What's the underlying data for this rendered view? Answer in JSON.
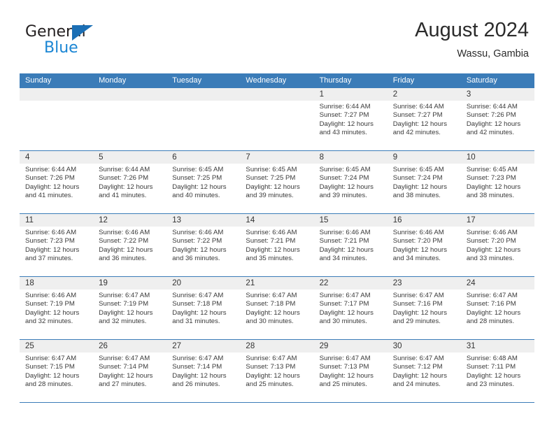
{
  "branding": {
    "name_dark": "General",
    "name_light": "Blue",
    "accent_blue": "#1b6fb5",
    "light_blue": "#1b86d4"
  },
  "header": {
    "title": "August 2024",
    "location": "Wassu, Gambia"
  },
  "calendar": {
    "header_bg": "#3b7cb8",
    "daynum_bg": "#efefef",
    "weekdays": [
      "Sunday",
      "Monday",
      "Tuesday",
      "Wednesday",
      "Thursday",
      "Friday",
      "Saturday"
    ],
    "weeks": [
      [
        {
          "day": "",
          "empty": true
        },
        {
          "day": "",
          "empty": true
        },
        {
          "day": "",
          "empty": true
        },
        {
          "day": "",
          "empty": true
        },
        {
          "day": "1",
          "sunrise": "Sunrise: 6:44 AM",
          "sunset": "Sunset: 7:27 PM",
          "daylight1": "Daylight: 12 hours",
          "daylight2": "and 43 minutes."
        },
        {
          "day": "2",
          "sunrise": "Sunrise: 6:44 AM",
          "sunset": "Sunset: 7:27 PM",
          "daylight1": "Daylight: 12 hours",
          "daylight2": "and 42 minutes."
        },
        {
          "day": "3",
          "sunrise": "Sunrise: 6:44 AM",
          "sunset": "Sunset: 7:26 PM",
          "daylight1": "Daylight: 12 hours",
          "daylight2": "and 42 minutes."
        }
      ],
      [
        {
          "day": "4",
          "sunrise": "Sunrise: 6:44 AM",
          "sunset": "Sunset: 7:26 PM",
          "daylight1": "Daylight: 12 hours",
          "daylight2": "and 41 minutes."
        },
        {
          "day": "5",
          "sunrise": "Sunrise: 6:44 AM",
          "sunset": "Sunset: 7:26 PM",
          "daylight1": "Daylight: 12 hours",
          "daylight2": "and 41 minutes."
        },
        {
          "day": "6",
          "sunrise": "Sunrise: 6:45 AM",
          "sunset": "Sunset: 7:25 PM",
          "daylight1": "Daylight: 12 hours",
          "daylight2": "and 40 minutes."
        },
        {
          "day": "7",
          "sunrise": "Sunrise: 6:45 AM",
          "sunset": "Sunset: 7:25 PM",
          "daylight1": "Daylight: 12 hours",
          "daylight2": "and 39 minutes."
        },
        {
          "day": "8",
          "sunrise": "Sunrise: 6:45 AM",
          "sunset": "Sunset: 7:24 PM",
          "daylight1": "Daylight: 12 hours",
          "daylight2": "and 39 minutes."
        },
        {
          "day": "9",
          "sunrise": "Sunrise: 6:45 AM",
          "sunset": "Sunset: 7:24 PM",
          "daylight1": "Daylight: 12 hours",
          "daylight2": "and 38 minutes."
        },
        {
          "day": "10",
          "sunrise": "Sunrise: 6:45 AM",
          "sunset": "Sunset: 7:23 PM",
          "daylight1": "Daylight: 12 hours",
          "daylight2": "and 38 minutes."
        }
      ],
      [
        {
          "day": "11",
          "sunrise": "Sunrise: 6:46 AM",
          "sunset": "Sunset: 7:23 PM",
          "daylight1": "Daylight: 12 hours",
          "daylight2": "and 37 minutes."
        },
        {
          "day": "12",
          "sunrise": "Sunrise: 6:46 AM",
          "sunset": "Sunset: 7:22 PM",
          "daylight1": "Daylight: 12 hours",
          "daylight2": "and 36 minutes."
        },
        {
          "day": "13",
          "sunrise": "Sunrise: 6:46 AM",
          "sunset": "Sunset: 7:22 PM",
          "daylight1": "Daylight: 12 hours",
          "daylight2": "and 36 minutes."
        },
        {
          "day": "14",
          "sunrise": "Sunrise: 6:46 AM",
          "sunset": "Sunset: 7:21 PM",
          "daylight1": "Daylight: 12 hours",
          "daylight2": "and 35 minutes."
        },
        {
          "day": "15",
          "sunrise": "Sunrise: 6:46 AM",
          "sunset": "Sunset: 7:21 PM",
          "daylight1": "Daylight: 12 hours",
          "daylight2": "and 34 minutes."
        },
        {
          "day": "16",
          "sunrise": "Sunrise: 6:46 AM",
          "sunset": "Sunset: 7:20 PM",
          "daylight1": "Daylight: 12 hours",
          "daylight2": "and 34 minutes."
        },
        {
          "day": "17",
          "sunrise": "Sunrise: 6:46 AM",
          "sunset": "Sunset: 7:20 PM",
          "daylight1": "Daylight: 12 hours",
          "daylight2": "and 33 minutes."
        }
      ],
      [
        {
          "day": "18",
          "sunrise": "Sunrise: 6:46 AM",
          "sunset": "Sunset: 7:19 PM",
          "daylight1": "Daylight: 12 hours",
          "daylight2": "and 32 minutes."
        },
        {
          "day": "19",
          "sunrise": "Sunrise: 6:47 AM",
          "sunset": "Sunset: 7:19 PM",
          "daylight1": "Daylight: 12 hours",
          "daylight2": "and 32 minutes."
        },
        {
          "day": "20",
          "sunrise": "Sunrise: 6:47 AM",
          "sunset": "Sunset: 7:18 PM",
          "daylight1": "Daylight: 12 hours",
          "daylight2": "and 31 minutes."
        },
        {
          "day": "21",
          "sunrise": "Sunrise: 6:47 AM",
          "sunset": "Sunset: 7:18 PM",
          "daylight1": "Daylight: 12 hours",
          "daylight2": "and 30 minutes."
        },
        {
          "day": "22",
          "sunrise": "Sunrise: 6:47 AM",
          "sunset": "Sunset: 7:17 PM",
          "daylight1": "Daylight: 12 hours",
          "daylight2": "and 30 minutes."
        },
        {
          "day": "23",
          "sunrise": "Sunrise: 6:47 AM",
          "sunset": "Sunset: 7:16 PM",
          "daylight1": "Daylight: 12 hours",
          "daylight2": "and 29 minutes."
        },
        {
          "day": "24",
          "sunrise": "Sunrise: 6:47 AM",
          "sunset": "Sunset: 7:16 PM",
          "daylight1": "Daylight: 12 hours",
          "daylight2": "and 28 minutes."
        }
      ],
      [
        {
          "day": "25",
          "sunrise": "Sunrise: 6:47 AM",
          "sunset": "Sunset: 7:15 PM",
          "daylight1": "Daylight: 12 hours",
          "daylight2": "and 28 minutes."
        },
        {
          "day": "26",
          "sunrise": "Sunrise: 6:47 AM",
          "sunset": "Sunset: 7:14 PM",
          "daylight1": "Daylight: 12 hours",
          "daylight2": "and 27 minutes."
        },
        {
          "day": "27",
          "sunrise": "Sunrise: 6:47 AM",
          "sunset": "Sunset: 7:14 PM",
          "daylight1": "Daylight: 12 hours",
          "daylight2": "and 26 minutes."
        },
        {
          "day": "28",
          "sunrise": "Sunrise: 6:47 AM",
          "sunset": "Sunset: 7:13 PM",
          "daylight1": "Daylight: 12 hours",
          "daylight2": "and 25 minutes."
        },
        {
          "day": "29",
          "sunrise": "Sunrise: 6:47 AM",
          "sunset": "Sunset: 7:13 PM",
          "daylight1": "Daylight: 12 hours",
          "daylight2": "and 25 minutes."
        },
        {
          "day": "30",
          "sunrise": "Sunrise: 6:47 AM",
          "sunset": "Sunset: 7:12 PM",
          "daylight1": "Daylight: 12 hours",
          "daylight2": "and 24 minutes."
        },
        {
          "day": "31",
          "sunrise": "Sunrise: 6:48 AM",
          "sunset": "Sunset: 7:11 PM",
          "daylight1": "Daylight: 12 hours",
          "daylight2": "and 23 minutes."
        }
      ]
    ]
  }
}
